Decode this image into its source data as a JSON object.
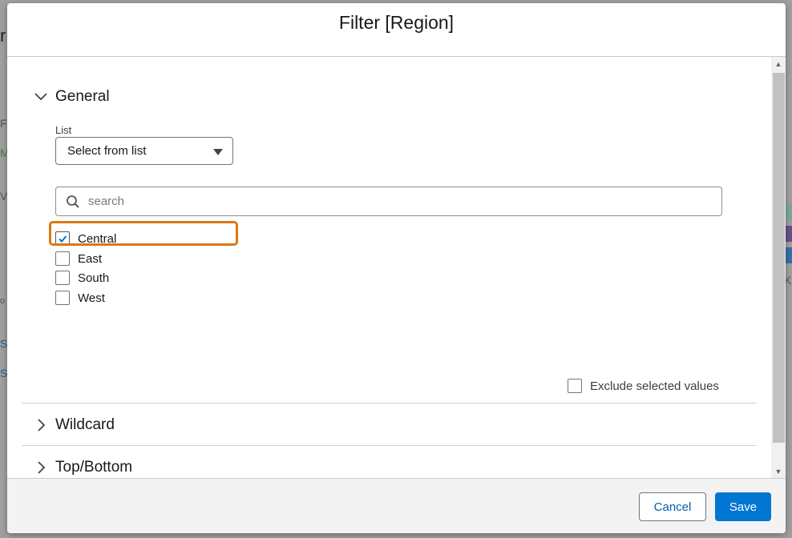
{
  "background": {
    "fragments": [
      "r",
      "Fi",
      "M",
      "V",
      "S",
      "S",
      "o",
      "K"
    ]
  },
  "modal": {
    "title": "Filter [Region]"
  },
  "sections": {
    "general": {
      "label": "General",
      "expanded": true,
      "list_label": "List",
      "select_value": "Select from list",
      "search_placeholder": "search",
      "search_value": "",
      "options": [
        {
          "label": "Central",
          "checked": true
        },
        {
          "label": "East",
          "checked": false
        },
        {
          "label": "South",
          "checked": false
        },
        {
          "label": "West",
          "checked": false
        }
      ],
      "exclude_label": "Exclude selected values"
    },
    "wildcard": {
      "label": "Wildcard",
      "expanded": false
    },
    "topbottom": {
      "label": "Top/Bottom",
      "expanded": false
    }
  },
  "footer": {
    "cancel_label": "Cancel",
    "save_label": "Save"
  },
  "colors": {
    "highlight": "#d97a10",
    "primary": "#0176d3",
    "link": "#0b5cab"
  },
  "icons": {
    "expanded": "chevron-down-icon",
    "collapsed": "chevron-right-icon",
    "search": "search-icon",
    "check": "check-icon"
  }
}
